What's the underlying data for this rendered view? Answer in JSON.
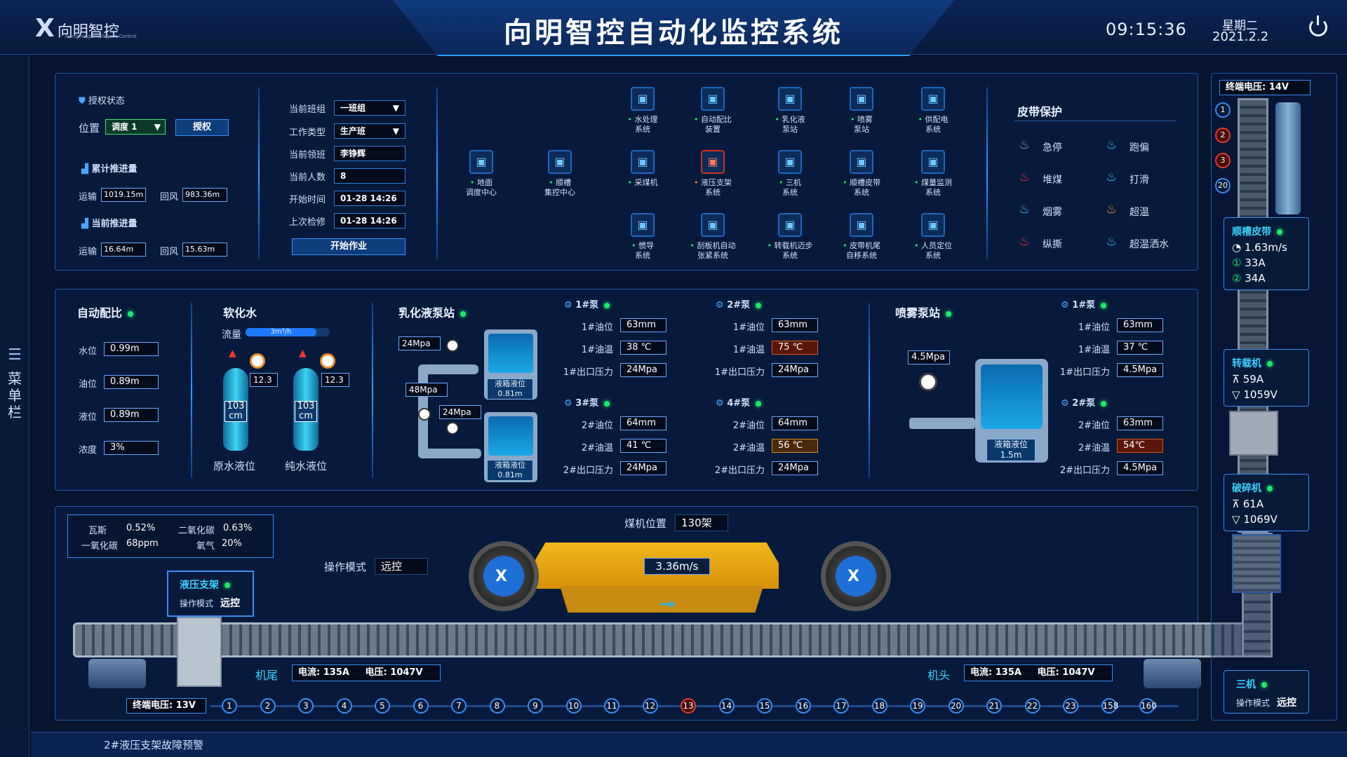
{
  "header": {
    "logo_text": "向明智控",
    "logo_sub": "Xiangming Intelligent Control",
    "title": "向明智控自动化监控系统",
    "time": "09:15:36",
    "weekday": "星期二",
    "date": "2021.2.2"
  },
  "sidebar": {
    "label": "菜单栏"
  },
  "auth": {
    "status_label": "授权状态",
    "position_label": "位置",
    "position_value": "调度 1",
    "authorize_button": "授权",
    "cumulative_label": "累计推进量",
    "transport_label": "运输",
    "return_label": "回风",
    "cum_transport": "1019.15m",
    "cum_return": "983.36m",
    "current_label": "当前推进量",
    "cur_transport": "16.64m",
    "cur_return": "15.63m"
  },
  "shift": {
    "team_label": "当前班组",
    "team_value": "一班组",
    "work_type_label": "工作类型",
    "work_type_value": "生产班",
    "leader_label": "当前领班",
    "leader_value": "李铮辉",
    "headcount_label": "当前人数",
    "headcount_value": "8",
    "start_label": "开始时间",
    "start_value": "01-28 14:26",
    "last_check_label": "上次检修",
    "last_check_value": "01-28 14:26",
    "start_button": "开始作业"
  },
  "systems": [
    {
      "label": "水处理",
      "label2": "系统",
      "icon": "water-treatment-icon"
    },
    {
      "label": "自动配比",
      "label2": "装置",
      "icon": "auto-ratio-icon"
    },
    {
      "label": "乳化液",
      "label2": "泵站",
      "icon": "emulsion-pump-icon"
    },
    {
      "label": "喷雾",
      "label2": "泵站",
      "icon": "spray-pump-icon"
    },
    {
      "label": "供配电",
      "label2": "系统",
      "icon": "power-supply-icon"
    },
    {
      "label": "地面",
      "label2": "调度中心",
      "icon": "ground-dispatch-icon"
    },
    {
      "label": "顺槽",
      "label2": "集控中心",
      "icon": "gateway-control-icon"
    },
    {
      "label": "采煤机",
      "label2": "",
      "icon": "shearer-icon"
    },
    {
      "label": "液压支架",
      "label2": "系统",
      "icon": "hydraulic-support-icon",
      "alert": true
    },
    {
      "label": "三机",
      "label2": "系统",
      "icon": "three-machine-icon"
    },
    {
      "label": "顺槽皮带",
      "label2": "系统",
      "icon": "gateway-belt-icon"
    },
    {
      "label": "煤量监测",
      "label2": "系统",
      "icon": "coal-monitor-icon"
    },
    {
      "label": "惯导",
      "label2": "系统",
      "icon": "inertial-nav-icon"
    },
    {
      "label": "刮板机自动",
      "label2": "张紧系统",
      "icon": "scraper-tension-icon"
    },
    {
      "label": "转载机迈步",
      "label2": "系统",
      "icon": "loader-step-icon"
    },
    {
      "label": "皮带机尾",
      "label2": "自移系统",
      "icon": "belt-tail-icon"
    },
    {
      "label": "人员定位",
      "label2": "系统",
      "icon": "personnel-location-icon"
    }
  ],
  "belt_protection": {
    "title": "皮带保护",
    "items": [
      {
        "label": "急停",
        "color": "#8a9ab8"
      },
      {
        "label": "跑偏",
        "color": "#3ab8e8"
      },
      {
        "label": "堆煤",
        "color": "#e83a2a"
      },
      {
        "label": "打滑",
        "color": "#3ab8e8"
      },
      {
        "label": "烟雾",
        "color": "#3ab8e8"
      },
      {
        "label": "超温",
        "color": "#e8902a"
      },
      {
        "label": "纵撕",
        "color": "#e83a2a"
      },
      {
        "label": "超温洒水",
        "color": "#3ab8e8"
      }
    ]
  },
  "auto_ratio": {
    "title": "自动配比",
    "rows": [
      {
        "label": "水位",
        "value": "0.99m"
      },
      {
        "label": "油位",
        "value": "0.89m"
      },
      {
        "label": "液位",
        "value": "0.89m"
      },
      {
        "label": "浓度",
        "value": "3%"
      }
    ]
  },
  "soft_water": {
    "title": "软化水",
    "flow_label": "流量",
    "flow_value": "3m³/h",
    "tank1_value": "103",
    "tank1_unit": "cm",
    "tank1_gauge": "12.3",
    "tank1_label": "原水液位",
    "tank2_value": "103",
    "tank2_unit": "cm",
    "tank2_gauge": "12.3",
    "tank2_label": "纯水液位"
  },
  "emulsion": {
    "title": "乳化液泵站",
    "p1": "24Mpa",
    "p2": "48Mpa",
    "p3": "24Mpa",
    "tank_label": "液箱液位",
    "tank1_value": "0.81m",
    "tank2_value": "0.81m",
    "pumps": [
      {
        "name": "1#泵",
        "rows": [
          [
            "1#油位",
            "63mm"
          ],
          [
            "1#油温",
            "38 ℃"
          ],
          [
            "1#出口压力",
            "24Mpa"
          ]
        ]
      },
      {
        "name": "2#泵",
        "rows": [
          [
            "1#油位",
            "63mm"
          ],
          [
            "1#油温",
            "75 ℃"
          ],
          [
            "1#出口压力",
            "24Mpa"
          ]
        ]
      },
      {
        "name": "3#泵",
        "rows": [
          [
            "2#油位",
            "64mm"
          ],
          [
            "2#油温",
            "41 ℃"
          ],
          [
            "2#出口压力",
            "24Mpa"
          ]
        ]
      },
      {
        "name": "4#泵",
        "rows": [
          [
            "2#油位",
            "64mm"
          ],
          [
            "2#油温",
            "56 ℃"
          ],
          [
            "2#出口压力",
            "24Mpa"
          ]
        ]
      }
    ]
  },
  "spray": {
    "title": "喷雾泵站",
    "pressure": "4.5Mpa",
    "tank_label": "液箱液位",
    "tank_value": "1.5m",
    "pumps": [
      {
        "name": "1#泵",
        "rows": [
          [
            "1#油位",
            "63mm"
          ],
          [
            "1#油温",
            "37 ℃"
          ],
          [
            "1#出口压力",
            "4.5Mpa"
          ]
        ]
      },
      {
        "name": "2#泵",
        "rows": [
          [
            "2#油位",
            "63mm"
          ],
          [
            "2#油温",
            "54℃"
          ],
          [
            "2#出口压力",
            "4.5Mpa"
          ]
        ]
      }
    ]
  },
  "gas": {
    "gas_label": "瓦斯",
    "gas_value": "0.52%",
    "co2_label": "二氧化碳",
    "co2_value": "0.63%",
    "co_label": "一氧化碳",
    "co_value": "68ppm",
    "o2_label": "氧气",
    "o2_value": "20%"
  },
  "face": {
    "shearer_pos_label": "煤机位置",
    "shearer_pos_value": "130架",
    "op_mode_label": "操作模式",
    "op_mode_value": "远控",
    "speed": "3.36m/s",
    "support_title": "液压支架",
    "support_mode_label": "操作模式",
    "support_mode_value": "远控",
    "tail_label": "机尾",
    "tail_info": "电流: 135A     电压: 1047V",
    "head_label": "机头",
    "head_info": "电流: 135A     电压: 1047V",
    "end_voltage": "终端电压: 13V",
    "supports": [
      "1",
      "2",
      "3",
      "4",
      "5",
      "6",
      "7",
      "8",
      "9",
      "10",
      "11",
      "12",
      "13",
      "14",
      "15",
      "16",
      "17",
      "18",
      "19",
      "20",
      "21",
      "22",
      "23",
      "158",
      "160"
    ],
    "alert_support": "13"
  },
  "right": {
    "end_voltage": "终端电压: 14V",
    "markers": [
      "1",
      "2",
      "3",
      "20"
    ],
    "belt_title": "顺槽皮带",
    "belt_speed": "1.63m/s",
    "belt_i1": "33A",
    "belt_i2": "34A",
    "loader_title": "转载机",
    "loader_a": "59A",
    "loader_v": "1059V",
    "crusher_title": "破碎机",
    "crusher_a": "61A",
    "crusher_v": "1069V",
    "three_title": "三机",
    "three_mode_label": "操作模式",
    "three_mode_value": "远控"
  },
  "footer": {
    "alarm": "2#液压支架故障预警"
  }
}
